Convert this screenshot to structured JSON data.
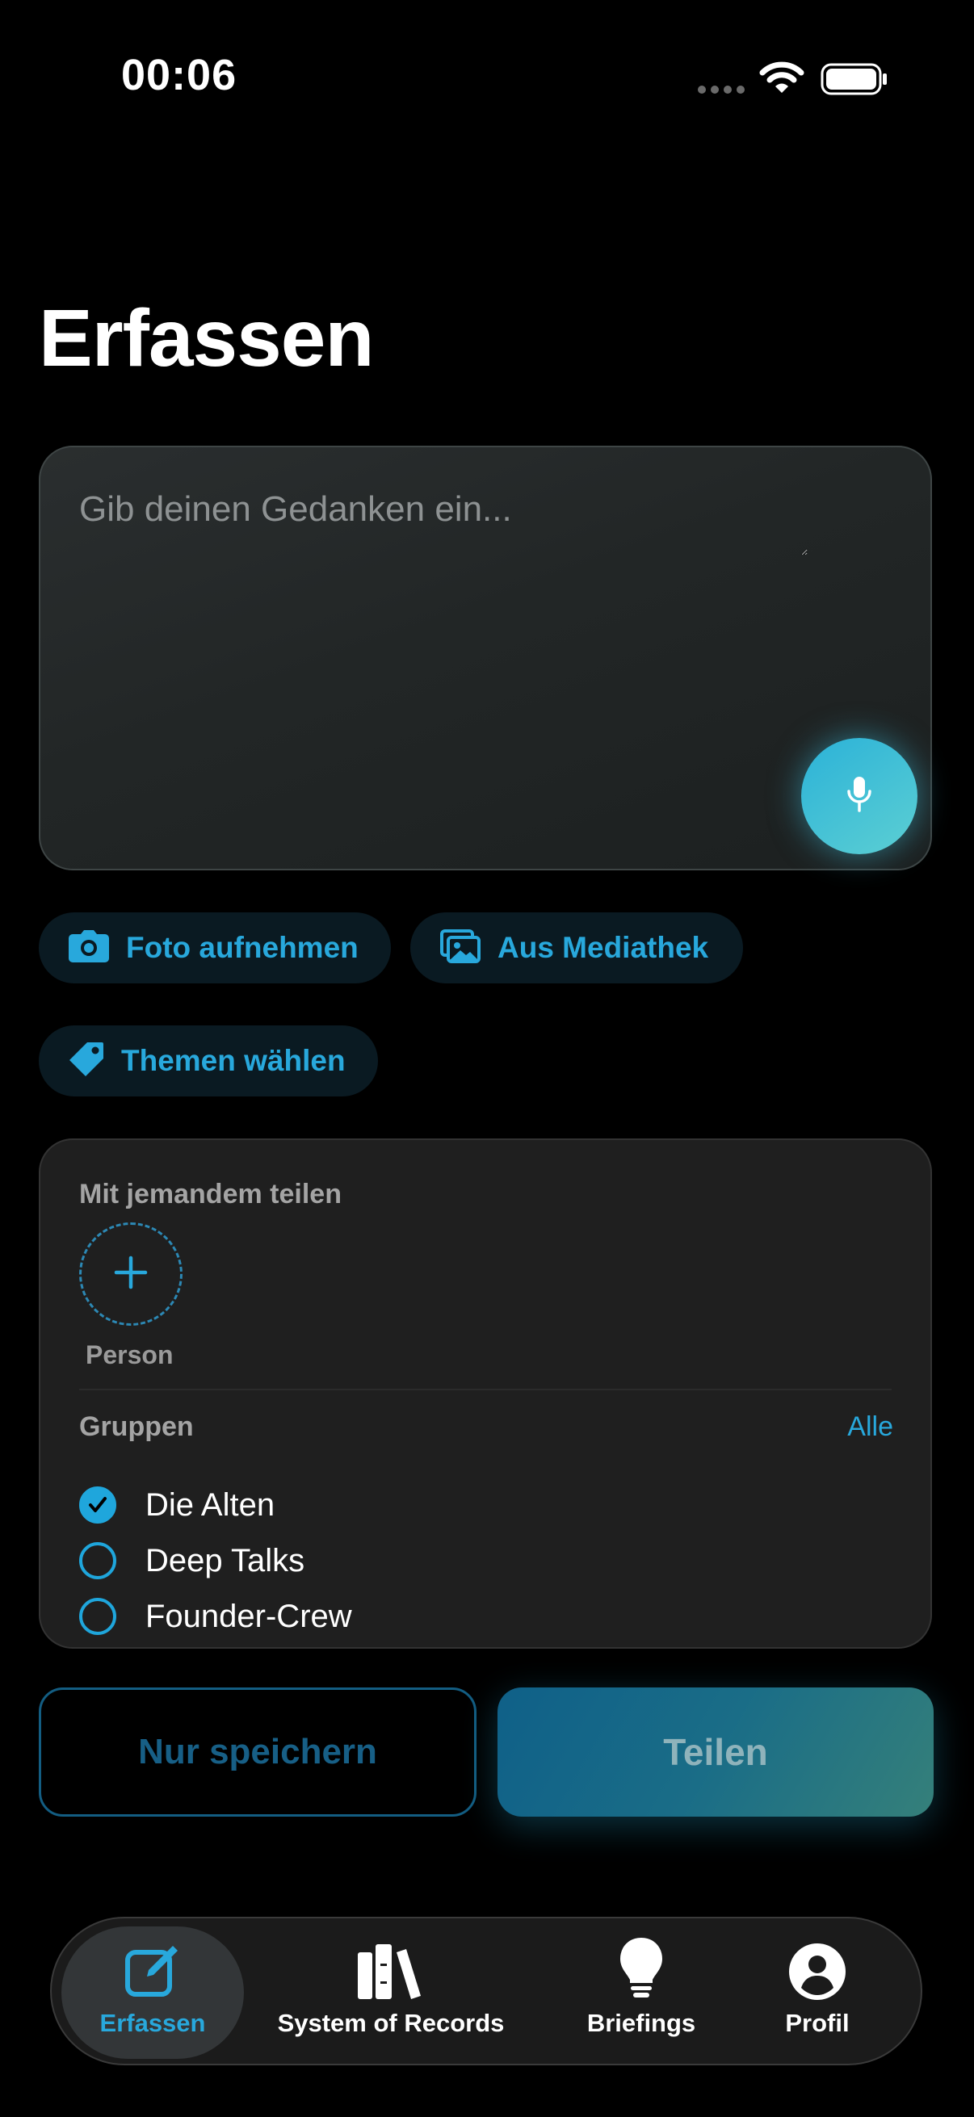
{
  "status_bar": {
    "time": "00:06"
  },
  "page": {
    "title": "Erfassen"
  },
  "composer": {
    "placeholder": "Gib deinen Gedanken ein..."
  },
  "actions": {
    "photo": "Foto aufnehmen",
    "library": "Aus Mediathek",
    "topics": "Themen wählen"
  },
  "share": {
    "heading": "Mit jemandem teilen",
    "add_person_label": "Person",
    "groups_heading": "Gruppen",
    "groups_all": "Alle",
    "groups": [
      {
        "label": "Die Alten",
        "checked": true
      },
      {
        "label": "Deep Talks",
        "checked": false
      },
      {
        "label": "Founder-Crew",
        "checked": false
      }
    ]
  },
  "buttons": {
    "save_only": "Nur speichern",
    "share": "Teilen"
  },
  "tabs": [
    {
      "label": "Erfassen",
      "icon": "compose-icon",
      "active": true
    },
    {
      "label": "System of Records",
      "icon": "books-icon",
      "active": false
    },
    {
      "label": "Briefings",
      "icon": "lightbulb-icon",
      "active": false
    },
    {
      "label": "Profil",
      "icon": "person-circle-icon",
      "active": false
    }
  ],
  "colors": {
    "accent": "#28a8dc",
    "background": "#000000",
    "card": "#1f1f1f"
  }
}
